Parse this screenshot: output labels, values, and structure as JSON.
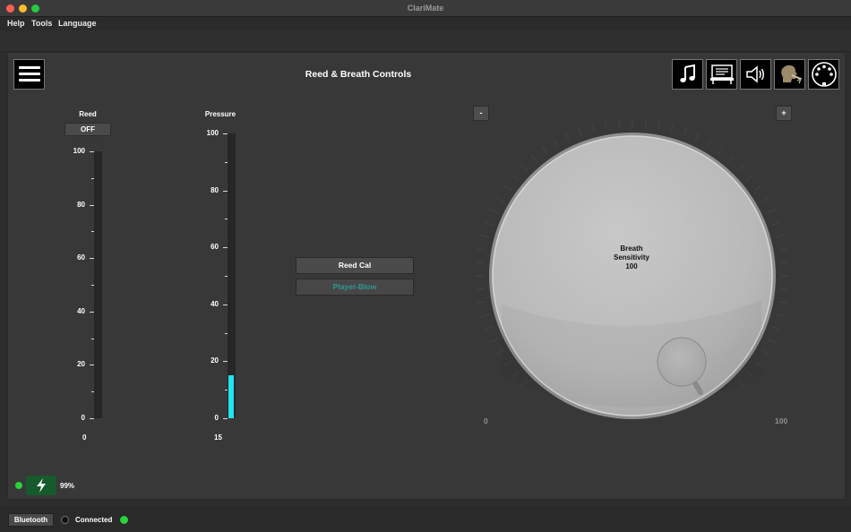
{
  "window": {
    "title": "ClariMate"
  },
  "menu": {
    "items": [
      "Help",
      "Tools",
      "Language"
    ]
  },
  "header": {
    "title": "Reed & Breath Controls"
  },
  "toolbar_icons": [
    "music-note-icon",
    "keyboard-icon",
    "speaker-icon",
    "player-head-icon",
    "midi-connector-icon"
  ],
  "reed": {
    "label": "Reed",
    "toggle_label": "OFF",
    "scale": [
      "100",
      "80",
      "60",
      "40",
      "20",
      "0"
    ],
    "value": "0",
    "level": 0
  },
  "pressure": {
    "label": "Pressure",
    "scale": [
      "100",
      "80",
      "60",
      "40",
      "20",
      "0"
    ],
    "value": "15",
    "level": 15
  },
  "buttons": {
    "reed_cal": "Reed Cal",
    "player_blow": "Player-Blow"
  },
  "knob": {
    "minus_label": "-",
    "plus_label": "+",
    "line1": "Breath",
    "line2": "Sensitivity",
    "value": "100",
    "min_label": "0",
    "max_label": "100",
    "level": 100
  },
  "battery": {
    "percent": "99%",
    "charging": true
  },
  "status": {
    "bluetooth_label": "Bluetooth",
    "connection_label": "Connected"
  },
  "colors": {
    "accent_fill": "#22e3ee",
    "led_green": "#28d23c",
    "battery_bg": "#175a2c"
  }
}
